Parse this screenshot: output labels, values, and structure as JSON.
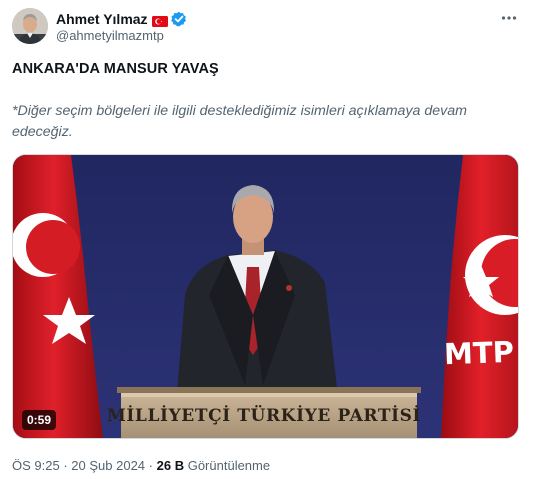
{
  "author": {
    "display_name": "Ahmet Yılmaz",
    "handle": "@ahmetyilmazmtp",
    "flag": "turkey-flag-icon",
    "verified": "verified-badge-icon",
    "verified_color": "#1d9bf0"
  },
  "tweet": {
    "headline": "ANKARA'DA MANSUR YAVAŞ",
    "quote": "*Diğer seçim bölgeleri ile ilgili desteklediğimiz isimleri açıklamaya devam edeceğiz."
  },
  "media": {
    "duration": "0:59",
    "podium_text": "MİLLİYETÇİ TÜRKİYE PARTİSİ",
    "flag_text": "MTP",
    "flag_color": "#e30a17",
    "backdrop_color": "#222a66"
  },
  "meta": {
    "time": "ÖS 9:25",
    "separator": "·",
    "date": "20 Şub 2024",
    "views_count": "26 B",
    "views_label": "Görüntülenme"
  },
  "icons": {
    "more": "more-options-icon"
  }
}
